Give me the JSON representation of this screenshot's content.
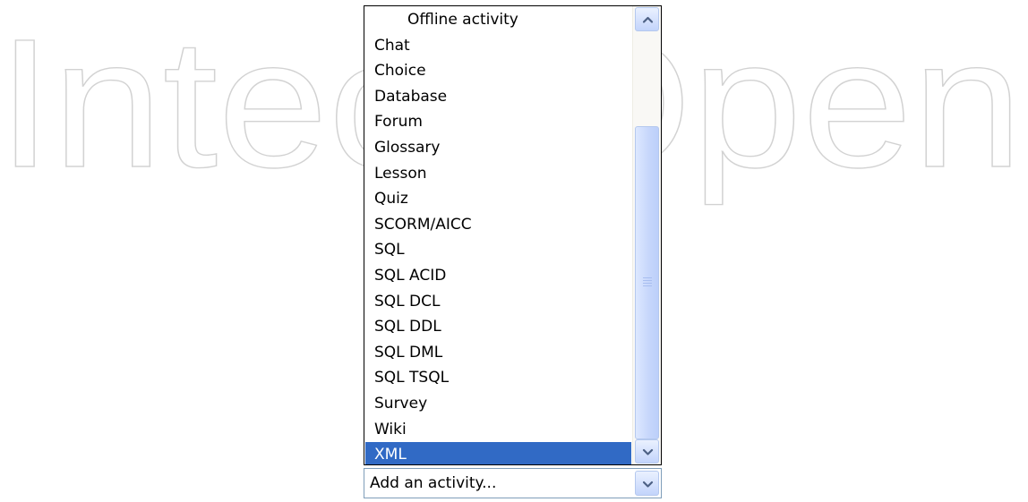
{
  "watermark": {
    "text": "IntechOpen"
  },
  "dropdown": {
    "options": [
      {
        "label": "Offline activity",
        "group": true,
        "selected": false
      },
      {
        "label": "Chat",
        "group": false,
        "selected": false
      },
      {
        "label": "Choice",
        "group": false,
        "selected": false
      },
      {
        "label": "Database",
        "group": false,
        "selected": false
      },
      {
        "label": "Forum",
        "group": false,
        "selected": false
      },
      {
        "label": "Glossary",
        "group": false,
        "selected": false
      },
      {
        "label": "Lesson",
        "group": false,
        "selected": false
      },
      {
        "label": "Quiz",
        "group": false,
        "selected": false
      },
      {
        "label": "SCORM/AICC",
        "group": false,
        "selected": false
      },
      {
        "label": "SQL",
        "group": false,
        "selected": false
      },
      {
        "label": "SQL ACID",
        "group": false,
        "selected": false
      },
      {
        "label": "SQL DCL",
        "group": false,
        "selected": false
      },
      {
        "label": "SQL DDL",
        "group": false,
        "selected": false
      },
      {
        "label": "SQL DML",
        "group": false,
        "selected": false
      },
      {
        "label": "SQL TSQL",
        "group": false,
        "selected": false
      },
      {
        "label": "Survey",
        "group": false,
        "selected": false
      },
      {
        "label": "Wiki",
        "group": false,
        "selected": false
      },
      {
        "label": "XML",
        "group": false,
        "selected": true
      }
    ]
  },
  "select": {
    "value": "Add an activity..."
  },
  "icons": {
    "scroll_up": "chevron-up-icon",
    "scroll_down": "chevron-down-icon",
    "select_arrow": "chevron-down-icon"
  },
  "colors": {
    "selection": "#316ac5",
    "selection_text": "#ffffff",
    "scrollbar_track": "#f9f8f5",
    "scrollbar_thumb": "#c6d6fb",
    "watermark": "#d2d2d2"
  }
}
